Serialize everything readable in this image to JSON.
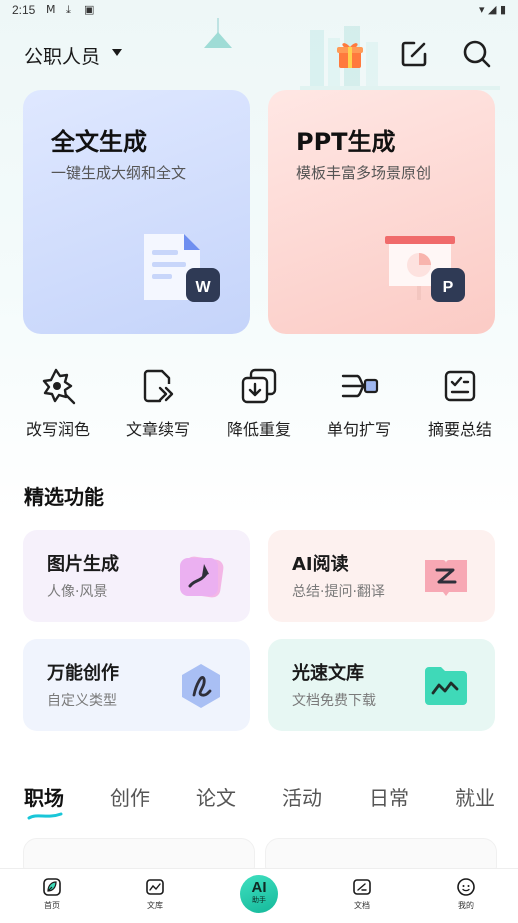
{
  "status_bar": {
    "time": "2:15",
    "icons": [
      "gmail-icon",
      "download-icon",
      "app-a-icon"
    ],
    "right_icons": [
      "wifi-icon",
      "signal-icon",
      "battery-icon"
    ]
  },
  "header": {
    "role": "公职人员",
    "icons": [
      "gift-icon",
      "edit-icon",
      "search-icon"
    ]
  },
  "big_cards": [
    {
      "title": "全文生成",
      "subtitle": "一键生成大纲和全文",
      "icon": "word-doc-icon",
      "badge": "W"
    },
    {
      "title": "PPT生成",
      "subtitle": "模板丰富多场景原创",
      "icon": "presentation-icon",
      "badge": "P"
    }
  ],
  "tools": [
    {
      "label": "改写润色",
      "icon": "polish-icon"
    },
    {
      "label": "文章续写",
      "icon": "continue-write-icon"
    },
    {
      "label": "降低重复",
      "icon": "reduce-duplicate-icon"
    },
    {
      "label": "单句扩写",
      "icon": "expand-sentence-icon"
    },
    {
      "label": "摘要总结",
      "icon": "summary-icon"
    }
  ],
  "featured": {
    "title": "精选功能",
    "items": [
      {
        "title": "图片生成",
        "subtitle": "人像·风景",
        "icon": "image-gen-icon"
      },
      {
        "title": "AI阅读",
        "subtitle": "总结·提问·翻译",
        "icon": "ai-read-icon"
      },
      {
        "title": "万能创作",
        "subtitle": "自定义类型",
        "icon": "universal-create-icon"
      },
      {
        "title": "光速文库",
        "subtitle": "文档免费下载",
        "icon": "library-icon"
      }
    ]
  },
  "category_tabs": [
    "职场",
    "创作",
    "论文",
    "活动",
    "日常",
    "就业"
  ],
  "active_tab": "职场",
  "bottom_nav": [
    {
      "label": "首页",
      "icon": "home-leaf-icon"
    },
    {
      "label": "文库",
      "icon": "library-chart-icon"
    },
    {
      "label": "助手",
      "icon": "ai-assistant-icon",
      "badge": "AI"
    },
    {
      "label": "文档",
      "icon": "document-icon"
    },
    {
      "label": "我的",
      "icon": "profile-face-icon"
    }
  ],
  "colors": {
    "accent": "#15b89a",
    "card_blue": "#c5d4fa",
    "card_pink": "#fbcbc5",
    "badge_dark": "#2f3a55"
  }
}
